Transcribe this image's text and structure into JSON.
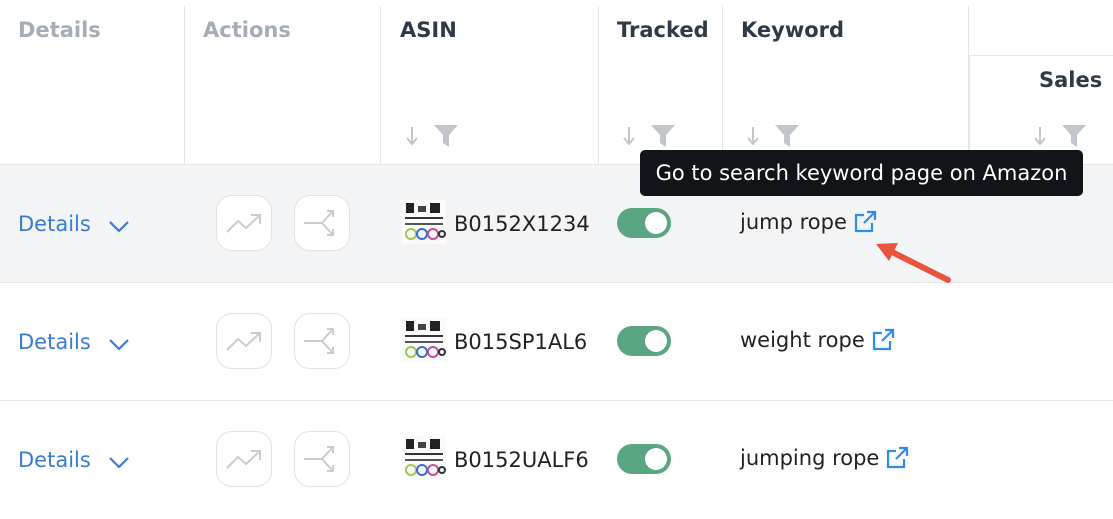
{
  "header": {
    "details": "Details",
    "actions": "Actions",
    "asin": "ASIN",
    "tracked": "Tracked",
    "keyword": "Keyword",
    "sales": "Sales"
  },
  "tooltip": {
    "text": "Go to search keyword page on Amazon"
  },
  "rows": [
    {
      "details_label": "Details",
      "asin": "B0152X1234",
      "tracked": true,
      "keyword": "jump rope"
    },
    {
      "details_label": "Details",
      "asin": "B015SP1AL6",
      "tracked": true,
      "keyword": "weight rope"
    },
    {
      "details_label": "Details",
      "asin": "B0152UALF6",
      "tracked": true,
      "keyword": "jumping rope"
    }
  ],
  "icons": {
    "chevron": "chevron-down-icon",
    "trend": "trending-up-icon",
    "merge": "merge-arrows-icon",
    "external": "external-link-icon",
    "sort": "sort-down-arrow-icon",
    "filter": "filter-funnel-icon"
  },
  "colors": {
    "link": "#3a7bd5",
    "toggle_on": "#5aa582",
    "tooltip_bg": "#111418",
    "annotation_arrow": "#e8543e",
    "external_icon": "#2d8cf0"
  }
}
